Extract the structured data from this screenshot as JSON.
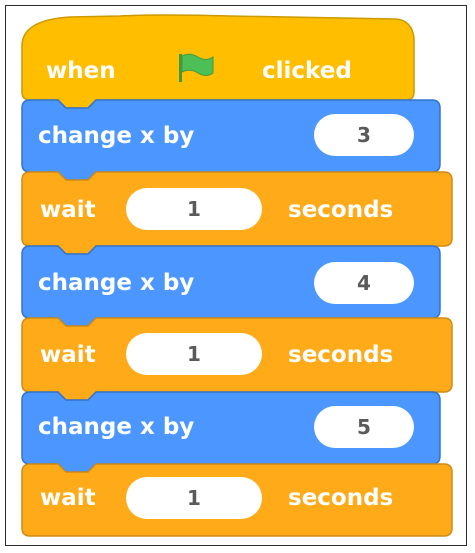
{
  "colors": {
    "event": "#ffbf00",
    "event_border": "#cc9900",
    "motion": "#4c97ff",
    "motion_border": "#3373cc",
    "control": "#ffab19",
    "control_border": "#cf8b17",
    "flag": "#4cbf56"
  },
  "script": {
    "hat": {
      "when": "when",
      "flag_icon": "green-flag-icon",
      "clicked": "clicked"
    },
    "blocks": [
      {
        "type": "motion",
        "label": "change x by",
        "value": "3"
      },
      {
        "type": "control",
        "label": "wait",
        "value": "1",
        "suffix": "seconds"
      },
      {
        "type": "motion",
        "label": "change x by",
        "value": "4"
      },
      {
        "type": "control",
        "label": "wait",
        "value": "1",
        "suffix": "seconds"
      },
      {
        "type": "motion",
        "label": "change x by",
        "value": "5"
      },
      {
        "type": "control",
        "label": "wait",
        "value": "1",
        "suffix": "seconds"
      }
    ]
  }
}
